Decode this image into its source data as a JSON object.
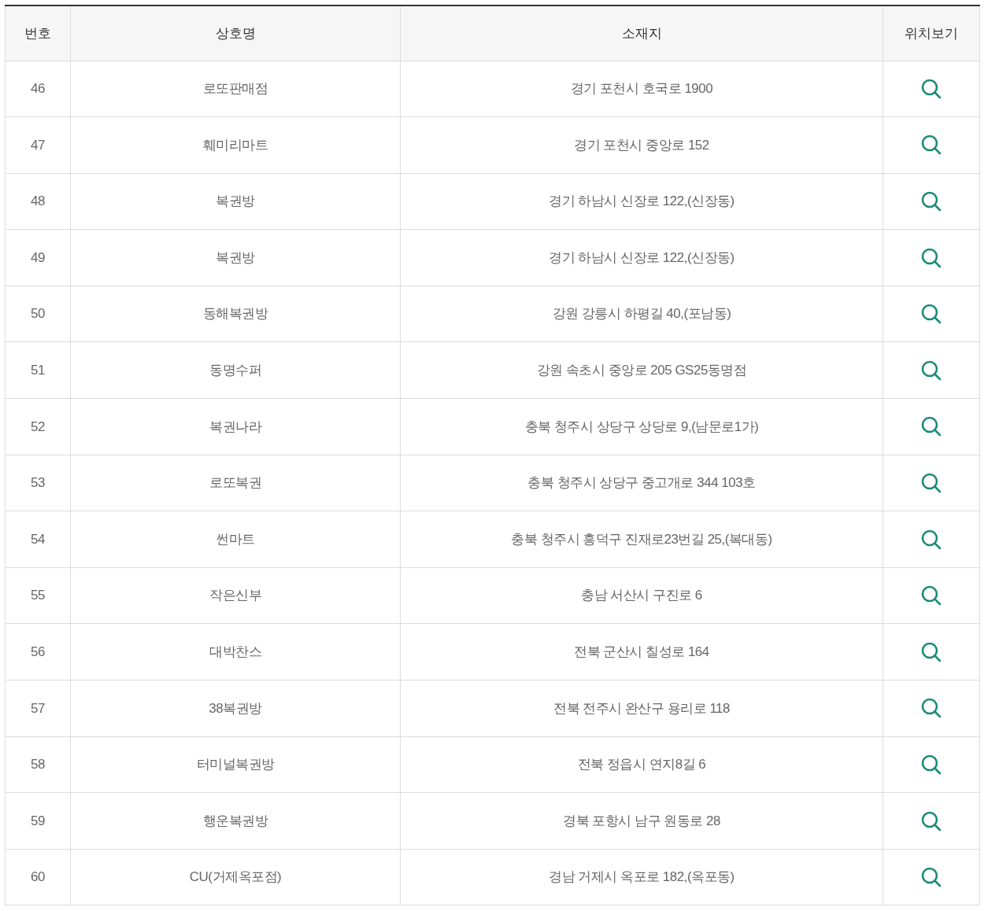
{
  "table": {
    "columns": [
      "번호",
      "상호명",
      "소재지",
      "위치보기"
    ],
    "rows": [
      {
        "number": "46",
        "name": "로또판매점",
        "address": "경기 포천시 호국로 1900"
      },
      {
        "number": "47",
        "name": "훼미리마트",
        "address": "경기 포천시 중앙로 152"
      },
      {
        "number": "48",
        "name": "복권방",
        "address": "경기 하남시 신장로 122,(신장동)"
      },
      {
        "number": "49",
        "name": "복권방",
        "address": "경기 하남시 신장로 122,(신장동)"
      },
      {
        "number": "50",
        "name": "동해복권방",
        "address": "강원 강릉시 하평길 40,(포남동)"
      },
      {
        "number": "51",
        "name": "동명수퍼",
        "address": "강원 속초시 중앙로 205 GS25동명점"
      },
      {
        "number": "52",
        "name": "복권나라",
        "address": "충북 청주시 상당구 상당로 9,(남문로1가)"
      },
      {
        "number": "53",
        "name": "로또복권",
        "address": "충북 청주시 상당구 중고개로 344 103호"
      },
      {
        "number": "54",
        "name": "썬마트",
        "address": "충북 청주시 흥덕구 진재로23번길 25,(복대동)"
      },
      {
        "number": "55",
        "name": "작은신부",
        "address": "충남 서산시 구진로 6"
      },
      {
        "number": "56",
        "name": "대박찬스",
        "address": "전북 군산시 칠성로 164"
      },
      {
        "number": "57",
        "name": "38복권방",
        "address": "전북 전주시 완산구 용리로 118"
      },
      {
        "number": "58",
        "name": "터미널복권방",
        "address": "전북 정읍시 연지8길 6"
      },
      {
        "number": "59",
        "name": "행운복권방",
        "address": "경북 포항시 남구 원동로 28"
      },
      {
        "number": "60",
        "name": "CU(거제옥포점)",
        "address": "경남 거제시 옥포로 182,(옥포동)"
      }
    ]
  }
}
